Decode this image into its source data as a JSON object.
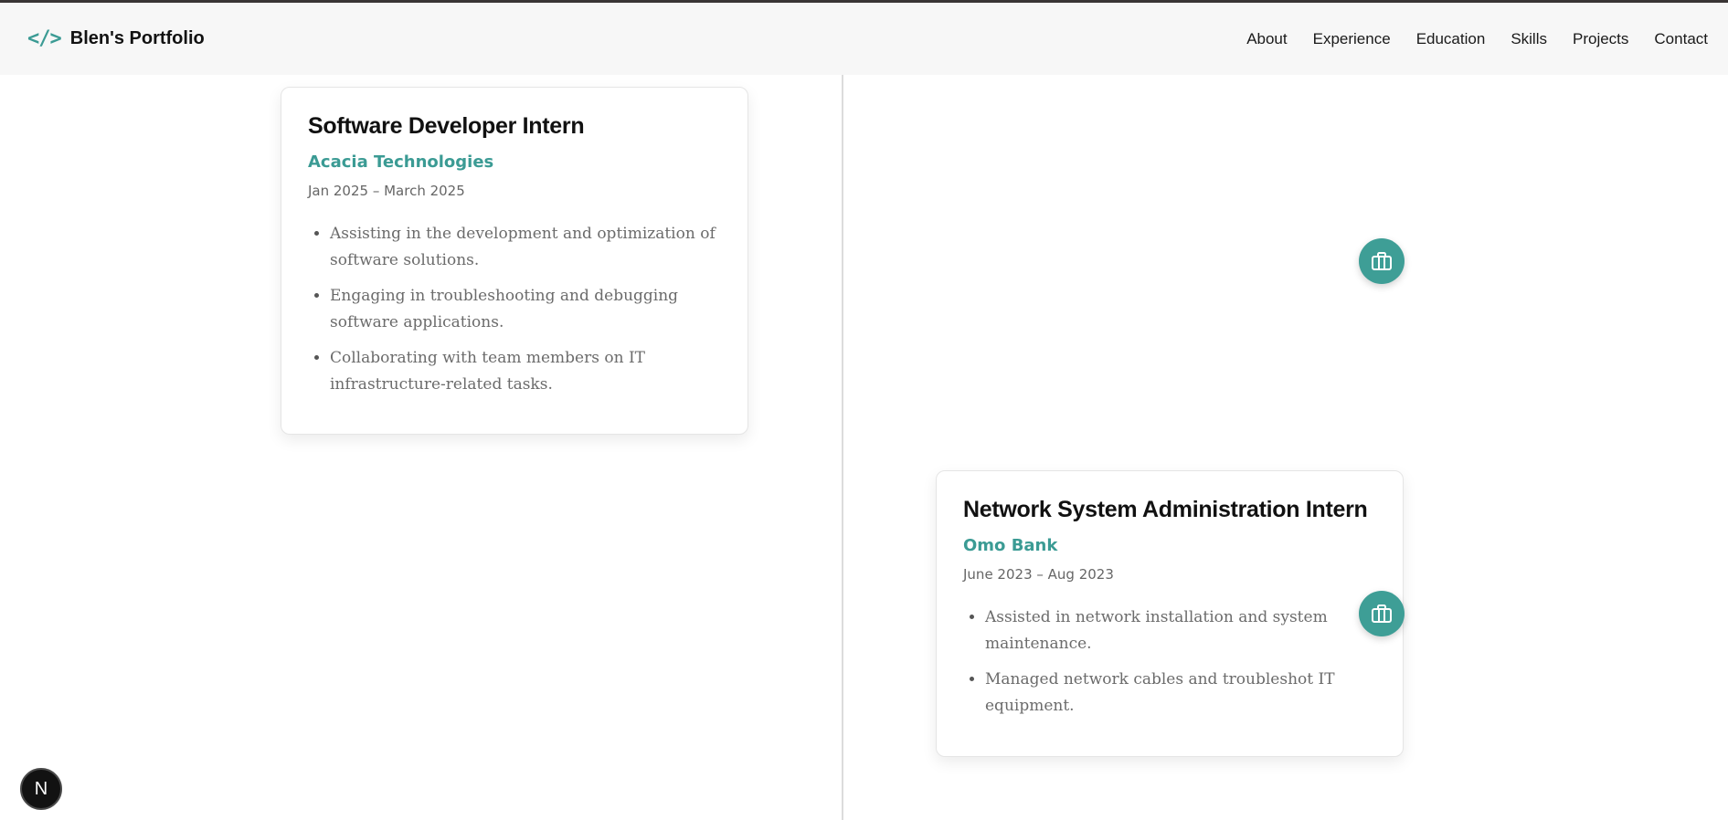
{
  "brand": {
    "name": "Blen's Portfolio",
    "icon": "code-brackets-icon",
    "accent": "#3b9b94"
  },
  "nav": {
    "items": [
      {
        "label": "About"
      },
      {
        "label": "Experience"
      },
      {
        "label": "Education"
      },
      {
        "label": "Skills"
      },
      {
        "label": "Projects"
      },
      {
        "label": "Contact"
      }
    ]
  },
  "experience": {
    "items": [
      {
        "role": "Software Developer Intern",
        "company": "Acacia Technologies",
        "dates": "Jan 2025 – March 2025",
        "bullets": [
          "Assisting in the development and optimization of software solutions.",
          "Engaging in troubleshooting and debugging software applications.",
          "Collaborating with team members on IT infrastructure-related tasks."
        ],
        "icon": "briefcase-icon"
      },
      {
        "role": "Network System Administration Intern",
        "company": "Omo Bank",
        "dates": "June 2023 – Aug 2023",
        "bullets": [
          "Assisted in network installation and system maintenance.",
          "Managed network cables and troubleshot IT equipment."
        ],
        "icon": "briefcase-icon"
      }
    ]
  },
  "badge": {
    "label": "N"
  }
}
